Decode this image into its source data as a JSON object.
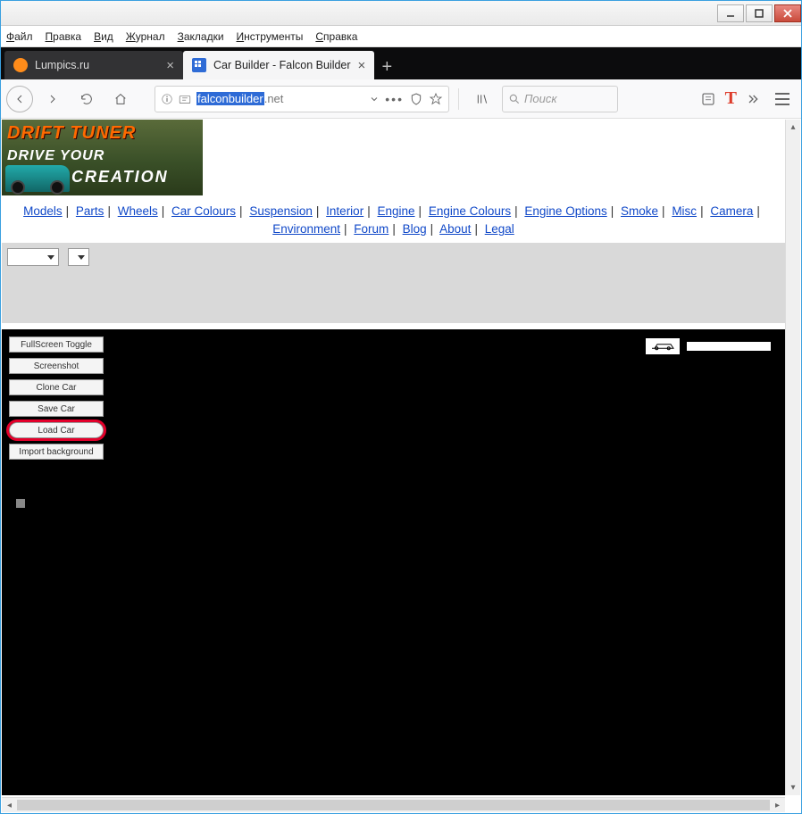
{
  "menubar": {
    "file": "Файл",
    "edit": "Правка",
    "view": "Вид",
    "history": "Журнал",
    "bookmarks": "Закладки",
    "tools": "Инструменты",
    "help": "Справка"
  },
  "tabs": {
    "tab1_title": "Lumpics.ru",
    "tab2_title": "Car Builder - Falcon Builder"
  },
  "url": {
    "selected": "falconbuilder",
    "rest": ".net"
  },
  "search": {
    "placeholder": "Поиск"
  },
  "banner": {
    "line1": "DRIFT TUNER",
    "line2": "DRIVE YOUR",
    "line3": "CREATION"
  },
  "navlinks": {
    "models": "Models",
    "parts": "Parts",
    "wheels": "Wheels",
    "car_colours": "Car Colours",
    "suspension": "Suspension",
    "interior": "Interior",
    "engine": "Engine",
    "engine_colours": "Engine Colours",
    "engine_options": "Engine Options",
    "smoke": "Smoke",
    "misc": "Misc",
    "camera": "Camera",
    "environment": "Environment",
    "forum": "Forum",
    "blog": "Blog",
    "about": "About",
    "legal": "Legal"
  },
  "buttons": {
    "fullscreen": "FullScreen Toggle",
    "screenshot": "Screenshot",
    "clone": "Clone Car",
    "save": "Save Car",
    "load": "Load Car",
    "importbg": "Import background"
  }
}
